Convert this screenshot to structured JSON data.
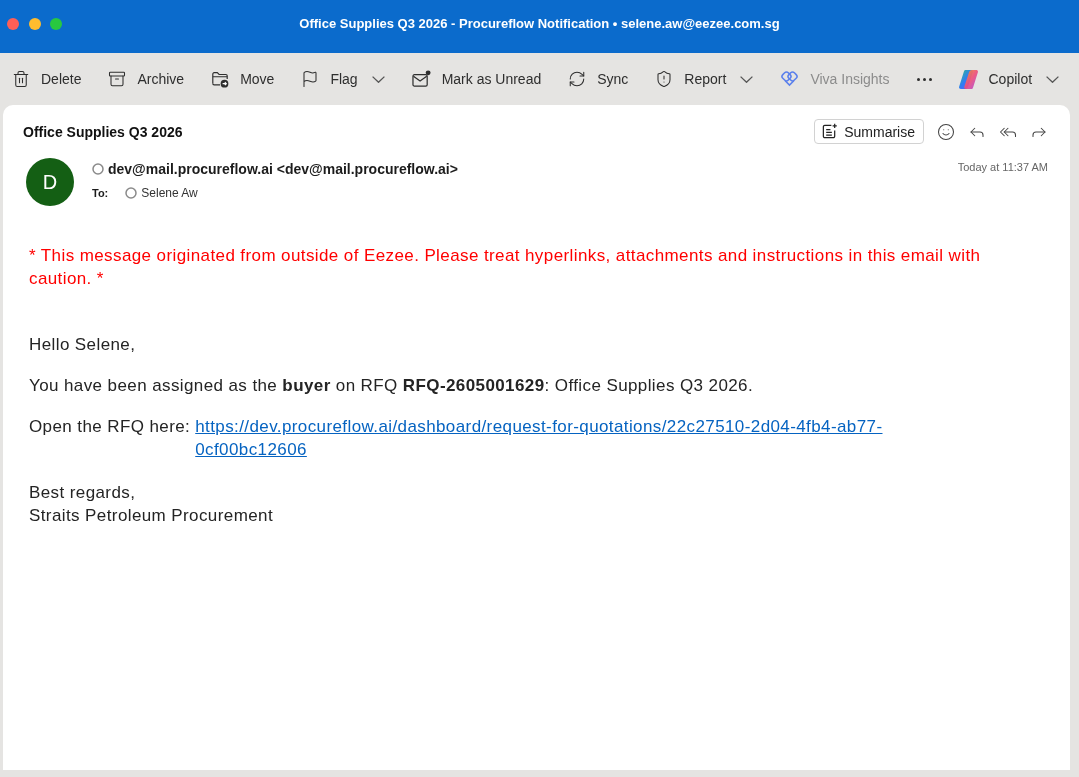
{
  "window": {
    "title": "Office Supplies Q3 2026 - Procureflow Notification • selene.aw@eezee.com.sg"
  },
  "toolbar": [
    {
      "kind": "delete",
      "label": "Delete",
      "dropdown": false,
      "disabled": false
    },
    {
      "kind": "archive",
      "label": "Archive",
      "dropdown": false,
      "disabled": false
    },
    {
      "kind": "move",
      "label": "Move",
      "dropdown": false,
      "disabled": false
    },
    {
      "kind": "flag",
      "label": "Flag",
      "dropdown": true,
      "disabled": false
    },
    {
      "kind": "unread",
      "label": "Mark as Unread",
      "dropdown": false,
      "disabled": false
    },
    {
      "kind": "sync",
      "label": "Sync",
      "dropdown": false,
      "disabled": false
    },
    {
      "kind": "report",
      "label": "Report",
      "dropdown": true,
      "disabled": false
    },
    {
      "kind": "insights",
      "label": "Viva Insights",
      "dropdown": false,
      "disabled": true
    },
    {
      "kind": "more",
      "dropdown": false,
      "disabled": false
    },
    {
      "kind": "copilot",
      "label": "Copilot",
      "dropdown": true,
      "disabled": false
    }
  ],
  "message": {
    "subject": "Office Supplies Q3 2026",
    "actions": [
      {
        "kind": "summarise",
        "label": "Summarise"
      },
      {
        "kind": "emoji"
      },
      {
        "kind": "reply"
      },
      {
        "kind": "reply_all"
      },
      {
        "kind": "forward"
      }
    ],
    "sender": {
      "initial": "D",
      "address": "dev@mail.procureflow.ai <dev@mail.procureflow.ai>"
    },
    "recipients_label": "To:",
    "recipients": [
      "Selene Aw"
    ],
    "date": "Today at 11:37 AM",
    "warning": "* This message originated from outside of Eezee. Please treat hyperlinks, attachments and instructions in this email with caution. *",
    "body": [
      {
        "kind": "paragraph",
        "text": "Hello Selene,"
      },
      {
        "kind": "paragraph",
        "text": "You have been assigned as the **buyer** on RFQ **RFQ-2605001629**: Office Supplies Q3 2026."
      },
      {
        "kind": "link",
        "text": "Open the RFQ here:",
        "link": "https://dev.procureflow.ai/dashboard/request-for-quotations/22c27510-2d04-4fb4-ab77-0cf00bc12606"
      },
      {
        "kind": "lines",
        "lines": [
          "Best regards,",
          "Straits Petroleum Procurement"
        ]
      }
    ]
  }
}
